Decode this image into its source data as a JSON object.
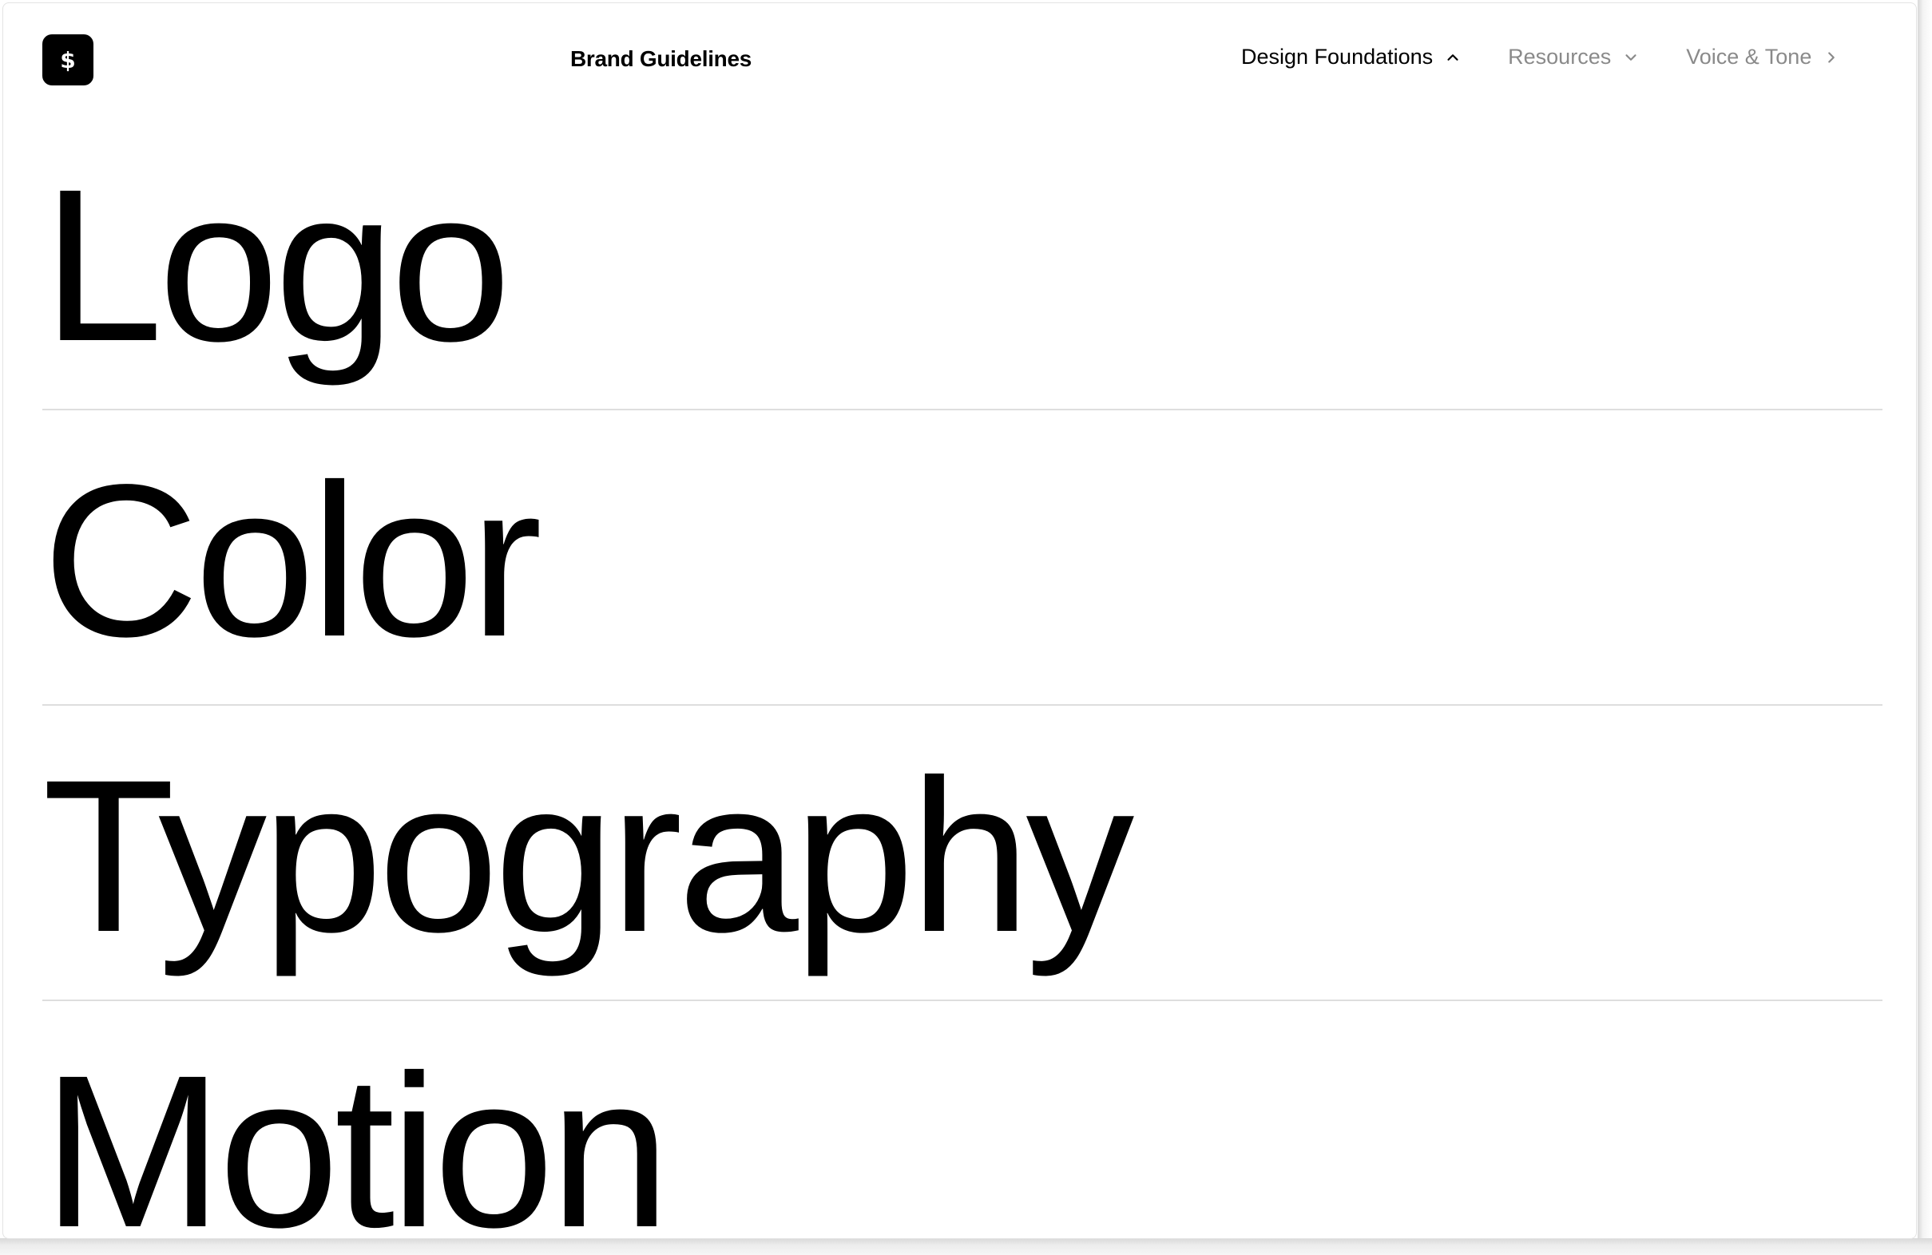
{
  "header": {
    "logo_glyph": "$",
    "site_title": "Brand Guidelines",
    "nav": [
      {
        "label": "Design Foundations",
        "state": "expanded",
        "icon": "chevron-up-icon"
      },
      {
        "label": "Resources",
        "state": "collapsed",
        "icon": "chevron-down-icon"
      },
      {
        "label": "Voice & Tone",
        "state": "link",
        "icon": "chevron-right-icon"
      }
    ]
  },
  "sections": [
    {
      "label": "Logo"
    },
    {
      "label": "Color"
    },
    {
      "label": "Typography"
    },
    {
      "label": "Motion"
    }
  ],
  "colors": {
    "text": "#000000",
    "muted_nav": "#8a8a8a",
    "divider": "#dedede",
    "background": "#ffffff"
  }
}
